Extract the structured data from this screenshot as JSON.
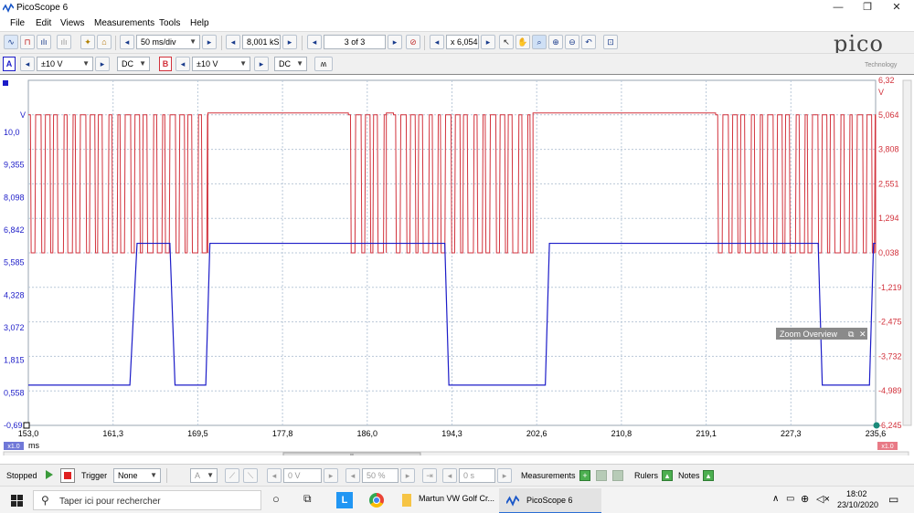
{
  "window": {
    "title": "PicoScope 6",
    "minimize": "—",
    "restore": "❐",
    "close": "✕"
  },
  "menu": [
    "File",
    "Edit",
    "Views",
    "Measurements",
    "Tools",
    "Help"
  ],
  "toolbar1": {
    "timebase": "50 ms/div",
    "samples": "8,001 kS",
    "buffer": "3 of 3",
    "zoom": "x 6,054"
  },
  "logo": {
    "brand": "pico",
    "sub": "Technology"
  },
  "toolbar2": {
    "channel_a": {
      "letter": "A",
      "range": "±10 V",
      "coupling": "DC"
    },
    "channel_b": {
      "letter": "B",
      "range": "±10 V",
      "coupling": "DC"
    }
  },
  "scope": {
    "left_unit": "V",
    "right_unit": "V",
    "left_axis": [
      "10,0",
      "9,355",
      "8,098",
      "6,842",
      "5,585",
      "4,328",
      "3,072",
      "1,815",
      "0,558",
      "-0,69"
    ],
    "right_axis": [
      "6,32",
      "5,064",
      "3,808",
      "2,551",
      "1,294",
      "0,038",
      "-1,219",
      "-2,475",
      "-3,732",
      "-4,989",
      "-6,245"
    ],
    "x_axis": [
      "153,0",
      "161,3",
      "169,5",
      "177,8",
      "186,0",
      "194,3",
      "202,6",
      "210,8",
      "219,1",
      "227,3",
      "235,6"
    ],
    "x_unit": "ms",
    "left_scale": "x1.0",
    "right_scale": "x1.0",
    "zoom_overview": "Zoom Overview",
    "scroll_grip": "II",
    "colors": {
      "channel_a": "#1c1cc8",
      "channel_b": "#d2323c",
      "grid": "#b9c8d8"
    }
  },
  "chart_data": {
    "type": "line",
    "x_range": [
      153.0,
      235.6
    ],
    "xlabel": "ms",
    "left_ylim": [
      -0.69,
      10.0
    ],
    "right_ylim": [
      -6.245,
      6.32
    ],
    "grid": true,
    "series": [
      {
        "name": "A",
        "color": "#1c1cc8",
        "points": [
          [
            153.0,
            0.558
          ],
          [
            162.9,
            0.558
          ],
          [
            163.6,
            4.95
          ],
          [
            166.8,
            4.95
          ],
          [
            167.3,
            0.558
          ],
          [
            170.3,
            0.558
          ],
          [
            170.7,
            4.95
          ],
          [
            193.6,
            4.95
          ],
          [
            194.0,
            0.558
          ],
          [
            203.4,
            0.558
          ],
          [
            203.8,
            4.95
          ],
          [
            230.0,
            4.95
          ],
          [
            230.4,
            0.558
          ],
          [
            235.0,
            0.558
          ],
          [
            235.4,
            4.95
          ],
          [
            235.6,
            4.95
          ]
        ]
      },
      {
        "name": "B",
        "color": "#d2323c",
        "state_sequence_note": "",
        "segments": [
          {
            "x0": 153.0,
            "x1": 170.5,
            "toggle": true
          },
          {
            "x0": 170.5,
            "x1": 184.2,
            "toggle": false
          },
          {
            "x0": 184.2,
            "x1": 187.9,
            "toggle": true
          },
          {
            "x0": 187.9,
            "x1": 188.6,
            "toggle": false
          },
          {
            "x0": 188.6,
            "x1": 202.2,
            "toggle": true
          },
          {
            "x0": 202.2,
            "x1": 220.0,
            "toggle": false
          },
          {
            "x0": 220.0,
            "x1": 235.6,
            "toggle": true
          }
        ],
        "high": 5.064,
        "low": 0.038
      }
    ]
  },
  "status": {
    "run_state": "Stopped",
    "trigger_label": "Trigger",
    "trigger_mode": "None",
    "trigger_channel": "A",
    "trigger_level": "0 V",
    "pretrigger": "50 %",
    "delay": "0 s",
    "measurements": "Measurements",
    "rulers": "Rulers",
    "notes": "Notes"
  },
  "taskbar": {
    "search_placeholder": "Taper ici pour rechercher",
    "app1": "Martun VW Golf Cr...",
    "app2": "PicoScope 6",
    "time": "18:02",
    "date": "23/10/2020"
  }
}
